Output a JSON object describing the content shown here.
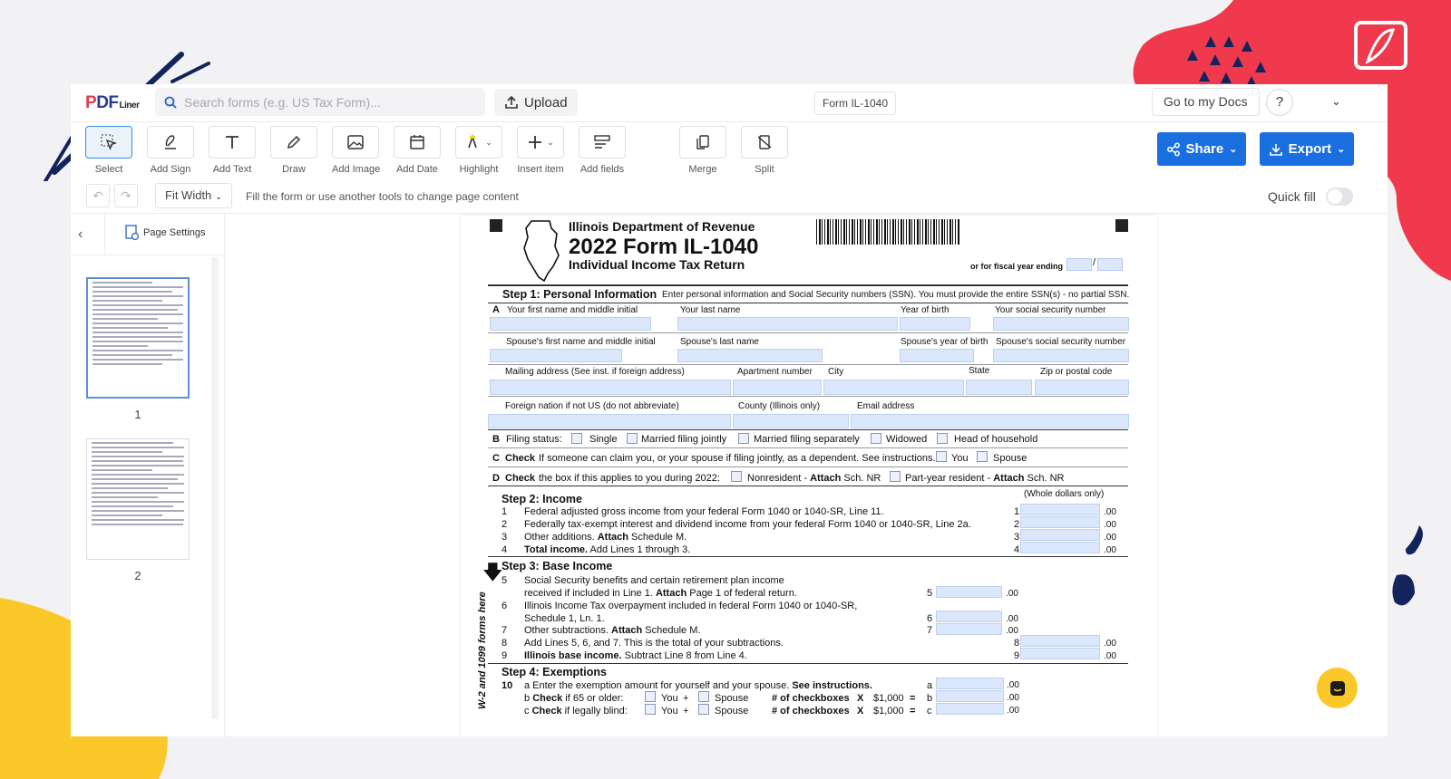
{
  "app": {
    "logo": {
      "p": "P",
      "df": "DF",
      "liner": "Liner"
    },
    "search": {
      "placeholder": "Search forms (e.g. US Tax Form)..."
    },
    "upload_label": "Upload",
    "doc_name": "Form IL-1040",
    "goto_docs": "Go to my Docs",
    "help_label": "?"
  },
  "toolbar": {
    "tools": [
      {
        "label": "Select",
        "icon": "select-cursor-icon"
      },
      {
        "label": "Add Sign",
        "icon": "signature-pen-icon"
      },
      {
        "label": "Add Text",
        "icon": "text-t-icon"
      },
      {
        "label": "Draw",
        "icon": "pencil-icon"
      },
      {
        "label": "Add Image",
        "icon": "image-icon"
      },
      {
        "label": "Add Date",
        "icon": "calendar-icon"
      },
      {
        "label": "Highlight",
        "icon": "highlighter-icon"
      },
      {
        "label": "Insert item",
        "icon": "plus-icon"
      },
      {
        "label": "Add fields",
        "icon": "fields-icon"
      },
      {
        "label": "Merge",
        "icon": "merge-icon"
      },
      {
        "label": "Split",
        "icon": "split-icon"
      }
    ],
    "share_label": "Share",
    "export_label": "Export"
  },
  "subbar": {
    "fit_width": "Fit Width",
    "hint": "Fill the form or use another tools to change page content",
    "quick_fill": "Quick fill"
  },
  "sidebar": {
    "page_settings": "Page Settings",
    "pages": [
      "1",
      "2"
    ]
  },
  "form": {
    "dept": "Illinois Department of Revenue",
    "title": "2022 Form IL-1040",
    "subtitle": "Individual Income Tax Return",
    "fiscal": "or for fiscal year ending",
    "fiscal_sep": "/",
    "step1": {
      "title": "Step 1: Personal Information",
      "desc": "Enter personal information and Social Security numbers (SSN).  You must provide the entire SSN(s) - no partial SSN.",
      "a": "A",
      "first_name": "Your first name and middle initial",
      "last_name": "Your last name",
      "year_birth": "Year of birth",
      "ssn": "Your social security number",
      "sp_first": "Spouse's first name and middle initial",
      "sp_last": "Spouse's last name",
      "sp_year": "Spouse's year of birth",
      "sp_ssn": "Spouse's social security number",
      "mailing": "Mailing address (See inst. if foreign address)",
      "apt": "Apartment number",
      "city": "City",
      "state": "State",
      "zip": "Zip or postal code",
      "foreign": "Foreign nation if not US (do not abbreviate)",
      "county": "County (Illinois only)",
      "email": "Email address",
      "b_letter": "B",
      "b_label": "Filing status:",
      "single": "Single",
      "mfj": "Married filing jointly",
      "mfs": "Married filing separately",
      "widowed": "Widowed",
      "hoh": "Head of household",
      "c_letter": "C",
      "c_bold": "Check",
      "c_text": "If someone can claim you, or your spouse if filing jointly, as a dependent. See instructions.",
      "you": "You",
      "spouse": "Spouse",
      "d_letter": "D",
      "d_bold": "Check",
      "d_text": "the box if this applies to you during 2022:",
      "nonres": "Nonresident -",
      "attach": "Attach",
      "schnr": "Sch. NR",
      "partyear": "Part-year resident -"
    },
    "step2": {
      "title": "Step 2: Income",
      "whole": "(Whole dollars only)",
      "lines": [
        {
          "n": "1",
          "text": "Federal adjusted gross income from your federal Form 1040 or 1040-SR, Line 11."
        },
        {
          "n": "2",
          "text": "Federally tax-exempt interest and dividend income from your federal Form 1040 or 1040-SR, Line 2a."
        },
        {
          "n": "3",
          "text": "Other additions.",
          "bold": "Attach",
          "tail": "Schedule M."
        },
        {
          "n": "4",
          "bold": "Total income.",
          "tail": "Add Lines 1 through 3."
        }
      ],
      "cents": ".00"
    },
    "step3": {
      "title": "Step 3: Base Income",
      "l5a": "Social Security benefits and certain retirement plan income",
      "l5b": "received if included in Line 1.",
      "l5b_bold": "Attach",
      "l5b_tail": "Page 1 of federal return.",
      "l6a": "Illinois Income Tax overpayment included in federal Form 1040 or 1040-SR,",
      "l6b": "Schedule 1, Ln. 1.",
      "l7": "Other subtractions.",
      "l7_bold": "Attach",
      "l7_tail": "Schedule M.",
      "l8": "Add Lines 5, 6, and 7. This is the total of your subtractions.",
      "l9_bold": "Illinois base income.",
      "l9_tail": "Subtract Line 8 from Line 4.",
      "nums": [
        "5",
        "6",
        "7",
        "8",
        "9"
      ]
    },
    "step4": {
      "title": "Step 4: Exemptions",
      "n10": "10",
      "a_text": "a  Enter the exemption amount for yourself and your spouse.",
      "a_bold": "See instructions.",
      "b_pre": "b",
      "b_bold": "Check",
      "b_text": "if 65 or older:",
      "c_pre": "c",
      "c_bold": "Check",
      "c_text": "if legally blind:",
      "you": "You",
      "plus": "+",
      "spouse": "Spouse",
      "checkboxes": "# of checkboxes",
      "times": "X",
      "amount": "$1,000",
      "eq": "=",
      "letters": [
        "a",
        "b",
        "c"
      ]
    },
    "side_text": "W-2 and 1099 forms here"
  },
  "colors": {
    "accent": "#1a6fe0",
    "field_fill": "#dbe7fb",
    "deco_red": "#f0394c",
    "deco_yellow": "#fbc82a",
    "deco_navy": "#13235c"
  }
}
